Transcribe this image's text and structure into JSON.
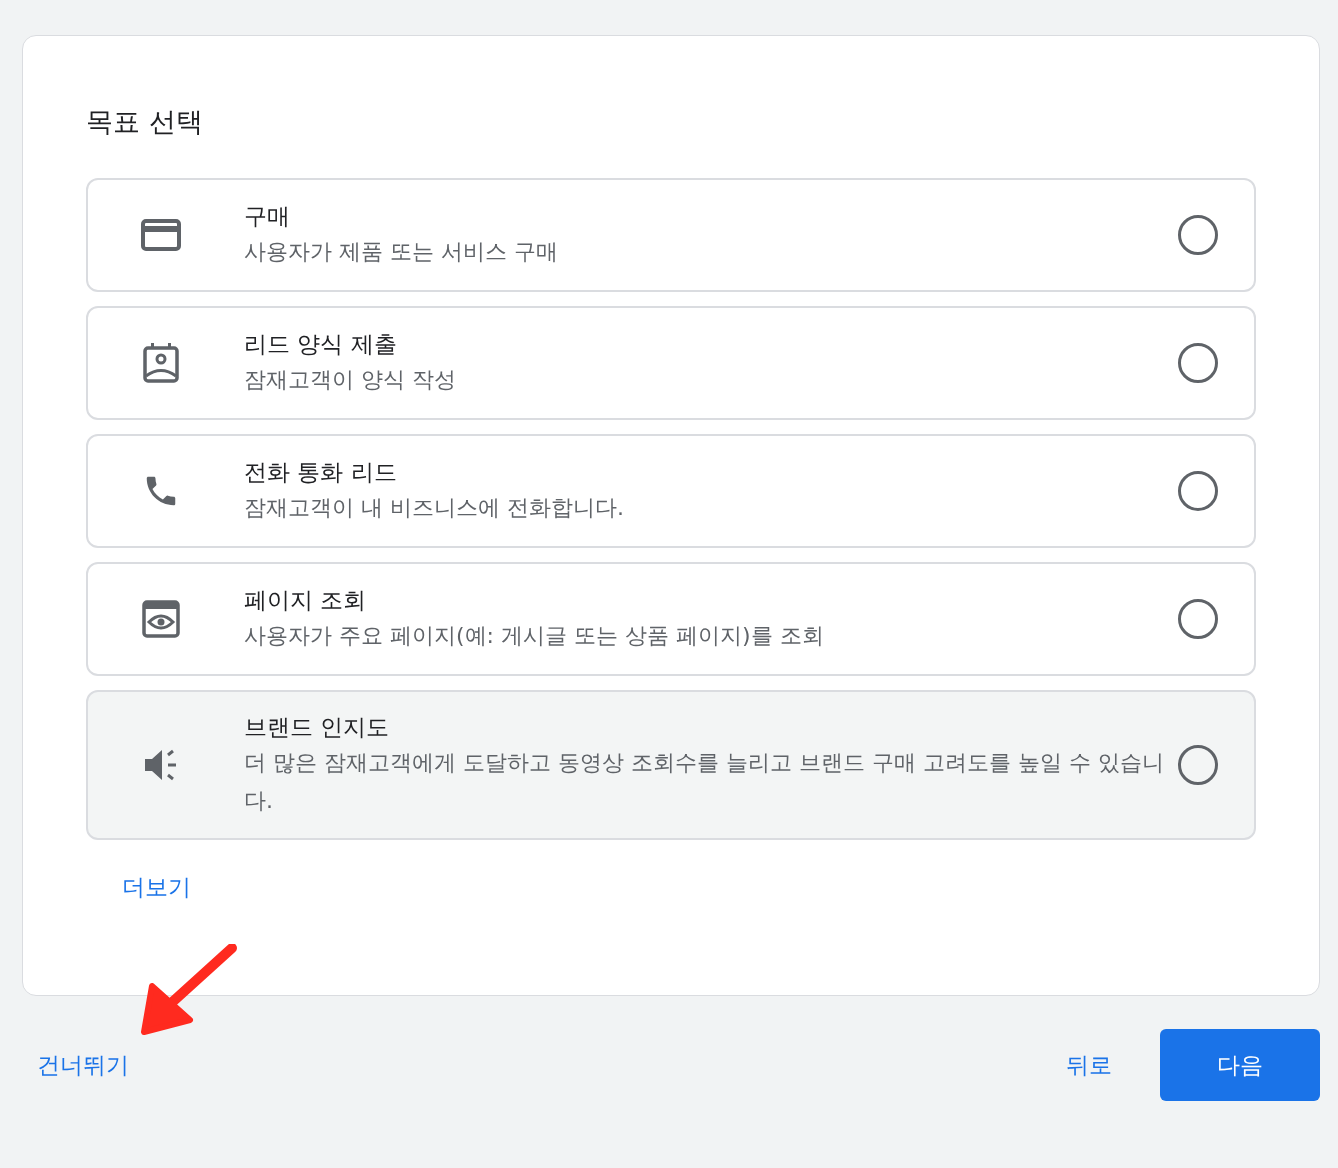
{
  "card": {
    "title": "목표 선택",
    "options": [
      {
        "kind": "card",
        "title": "구매",
        "description": "사용자가 제품 또는 서비스 구매",
        "selected": false,
        "highlighted": false
      },
      {
        "kind": "contact",
        "title": "리드 양식 제출",
        "description": "잠재고객이 양식 작성",
        "selected": false,
        "highlighted": false
      },
      {
        "kind": "phone",
        "title": "전화 통화 리드",
        "description": "잠재고객이 내 비즈니스에 전화합니다.",
        "selected": false,
        "highlighted": false
      },
      {
        "kind": "page",
        "title": "페이지 조회",
        "description": "사용자가 주요 페이지(예: 게시글 또는 상품 페이지)를 조회",
        "selected": false,
        "highlighted": false
      },
      {
        "kind": "speaker",
        "title": "브랜드 인지도",
        "description": "더 많은 잠재고객에게 도달하고 동영상 조회수를 늘리고 브랜드 구매 고려도를 높일 수 있습니다.",
        "selected": false,
        "highlighted": true
      }
    ],
    "more_link": "더보기"
  },
  "footer": {
    "skip": "건너뛰기",
    "back": "뒤로",
    "next": "다음"
  }
}
